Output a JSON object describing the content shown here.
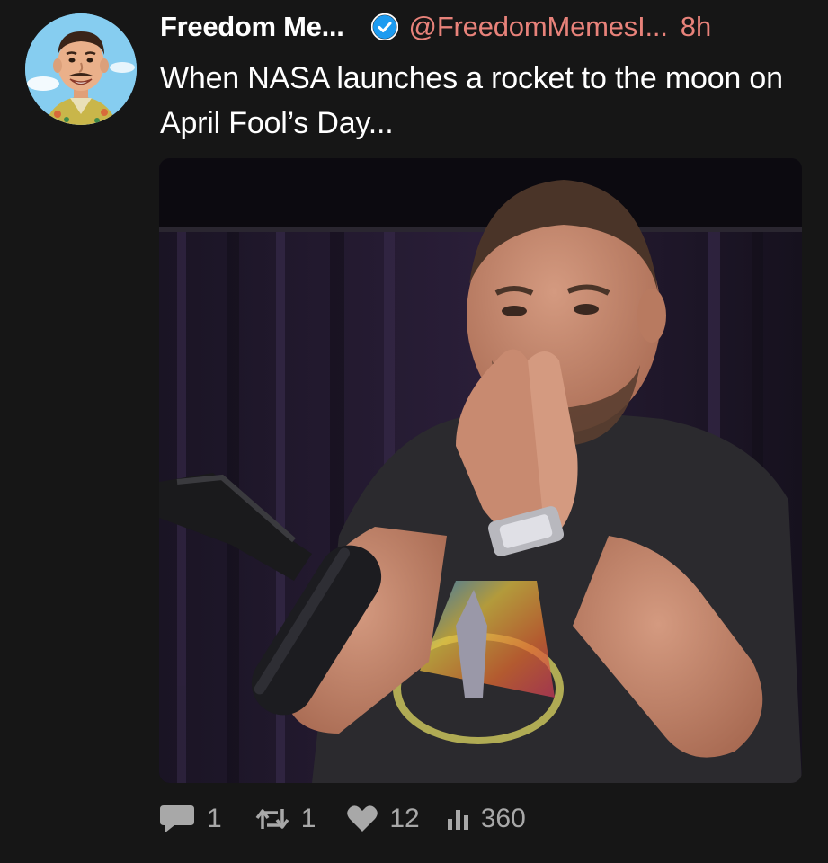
{
  "tweet": {
    "display_name": "Freedom Me...",
    "verified": true,
    "handle": "@FreedomMemesI...",
    "time": "8h",
    "text": "When NASA launches a rocket to the moon on April Fool’s Day..."
  },
  "media": {
    "type": "photo"
  },
  "actions": {
    "replies": "1",
    "retweets": "1",
    "likes": "12",
    "views": "360"
  },
  "icons": {
    "reply": "speech-bubble-icon",
    "retweet": "retweet-arrows-icon",
    "like": "heart-icon",
    "views": "bar-chart-icon",
    "verified": "verified-badge-icon"
  },
  "colors": {
    "background": "#161616",
    "handle": "#e8827a",
    "verified": "#1d9bf0",
    "action_text": "#a8a8a8"
  }
}
